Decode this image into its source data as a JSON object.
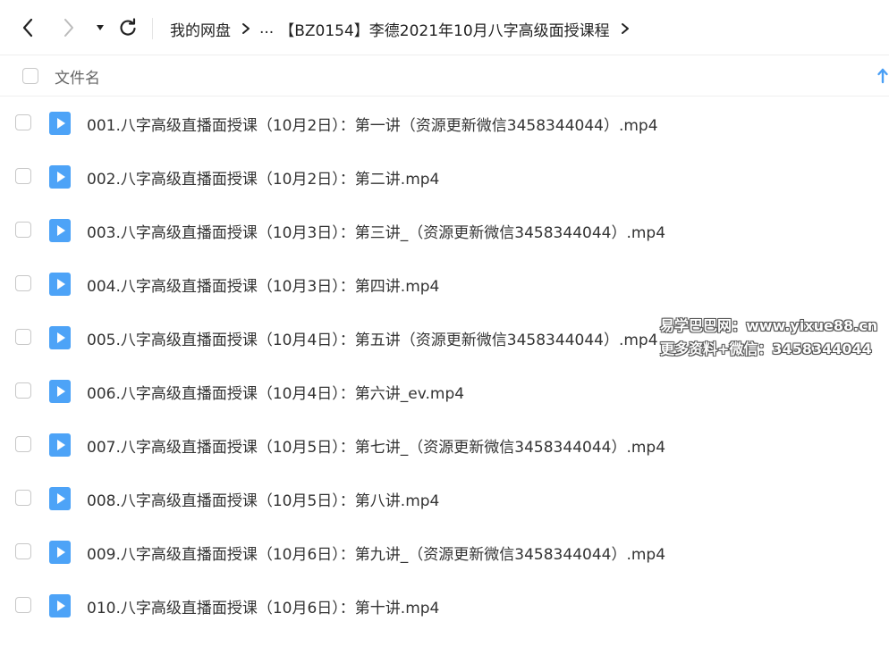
{
  "breadcrumb": {
    "root": "我的网盘",
    "ellipsis": "...",
    "current": "【BZ0154】李德2021年10月八字高级面授课程"
  },
  "header": {
    "name_column": "文件名"
  },
  "files": [
    {
      "name": "001.八字高级直播面授课（10月2日）：第一讲（资源更新微信3458344044）.mp4"
    },
    {
      "name": "002.八字高级直播面授课（10月2日）：第二讲.mp4"
    },
    {
      "name": "003.八字高级直播面授课（10月3日）：第三讲_（资源更新微信3458344044）.mp4"
    },
    {
      "name": "004.八字高级直播面授课（10月3日）：第四讲.mp4"
    },
    {
      "name": "005.八字高级直播面授课（10月4日）：第五讲（资源更新微信3458344044）.mp4"
    },
    {
      "name": "006.八字高级直播面授课（10月4日）：第六讲_ev.mp4"
    },
    {
      "name": "007.八字高级直播面授课（10月5日）：第七讲_（资源更新微信3458344044）.mp4"
    },
    {
      "name": "008.八字高级直播面授课（10月5日）：第八讲.mp4"
    },
    {
      "name": "009.八字高级直播面授课（10月6日）：第九讲_（资源更新微信3458344044）.mp4"
    },
    {
      "name": "010.八字高级直播面授课（10月6日）：第十讲.mp4"
    }
  ],
  "watermark": {
    "line1": "易学巴巴网：www.yixue88.cn",
    "line2": "更多资料+微信：3458344044"
  },
  "colors": {
    "accent": "#4a9ff5",
    "video_icon": "#4da3f7"
  }
}
